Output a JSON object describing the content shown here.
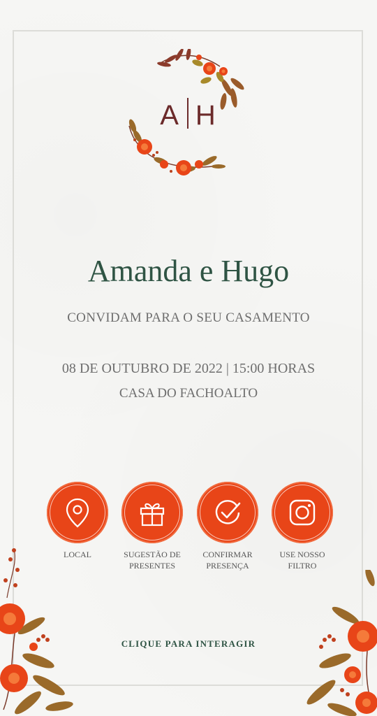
{
  "monogram": {
    "left": "A",
    "right": "H"
  },
  "couple_names": "Amanda e Hugo",
  "subtitle": "CONVIDAM PARA O SEU CASAMENTO",
  "datetime": "08 DE OUTUBRO DE 2022 |  15:00 HORAS",
  "venue": "CASA DO FACHOALTO",
  "actions": [
    {
      "label": "LOCAL",
      "icon": "map-pin-icon"
    },
    {
      "label": "SUGESTÃO DE\nPRESENTES",
      "icon": "gift-icon"
    },
    {
      "label": "CONFIRMAR\nPRESENÇA",
      "icon": "check-circle-icon"
    },
    {
      "label": "USE NOSSO\nFILTRO",
      "icon": "instagram-icon"
    }
  ],
  "cta": "CLIQUE  PARA  INTERAGIR",
  "colors": {
    "accent": "#e84518",
    "names": "#2f5444",
    "monogram": "#6b2a2a",
    "text": "#6e6e6e"
  }
}
